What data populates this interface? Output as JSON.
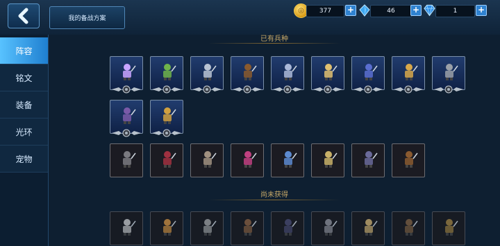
{
  "header": {
    "plan_button_label": "我的备战方案",
    "gold_amount": "377",
    "crystal_amount": "46",
    "diamond_amount": "1"
  },
  "sidebar": {
    "items": [
      {
        "label": "阵容",
        "active": true
      },
      {
        "label": "铭文",
        "active": false
      },
      {
        "label": "装备",
        "active": false
      },
      {
        "label": "光环",
        "active": false
      },
      {
        "label": "宠物",
        "active": false
      }
    ]
  },
  "main": {
    "owned_title": "已有兵种",
    "unowned_title": "尚未获得"
  },
  "colors": {
    "accent_blue": "#2f82d0",
    "active_tab": "#58c2ff",
    "section_gold": "#c5a767"
  },
  "icons": {
    "back": "chevron-left-icon",
    "gold": "gold-coin-icon",
    "crystal": "blue-crystal-icon",
    "diamond": "diamond-icon",
    "plus": "plus-icon"
  }
}
